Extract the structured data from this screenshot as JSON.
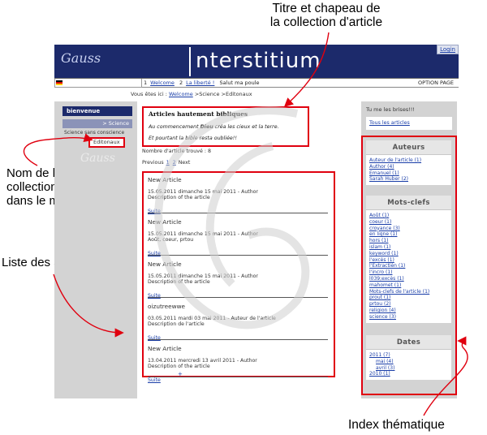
{
  "annotations": {
    "title_callout": [
      "Titre et chapeau de",
      "la collection d'article"
    ],
    "menu_callout": [
      "Nom de la",
      "collection d'article",
      "dans le menu"
    ],
    "list_callout": "Liste des articles",
    "index_callout": "Index thématique"
  },
  "site": {
    "logo_text": "Gauss",
    "title": "nterstitium",
    "login": "Login",
    "nav": {
      "item1_num": "1",
      "item1_label": "Welcome",
      "item2_num": "2",
      "item2_label": "La liberté !",
      "item3_label": "Salut ma poule",
      "option_page": "OPTION PAGE"
    },
    "breadcrumb": {
      "prefix": "Vous êtes ici :",
      "link": "Welcome",
      "rest": ">Science >Editonaux"
    }
  },
  "left_menu": {
    "bienvenue": "bienvenue",
    "science": "> Science",
    "science_sub": "Science sans conscience",
    "editonaux": "Editonaux"
  },
  "main": {
    "chapeau_title": "Articles hautement bibliques",
    "chapeau_line1_pre": "Au commencement",
    "chapeau_line1_bold": "Dieu",
    "chapeau_line1_post": "créa les cieux et la terre.",
    "chapeau_line2": "Et pourtant la bible resta oubliée!!",
    "count_text": "Nombre d'article trouvé : 8",
    "pager": {
      "prev": "Previous",
      "page1": "1",
      "page2": "2",
      "next": "Next"
    },
    "articles": [
      {
        "title": "New Article",
        "meta": "15.05.2011 dimanche 15 mai 2011 - Author",
        "desc": "Description of the article",
        "more": "Suite"
      },
      {
        "title": "New Article",
        "meta": "15.05.2011 dimanche 15 mai 2011 - Author",
        "desc": "Août, coeur, prtou",
        "more": "Suite"
      },
      {
        "title": "New Article",
        "meta": "15.05.2011 dimanche 15 mai 2011 - Author",
        "desc": "Description of the article",
        "more": "Suite"
      },
      {
        "title": "oizutreewwe",
        "meta": "03.05.2011 mardi 03 mai 2011 - Auteur de l'article",
        "desc": "Description de l'article",
        "more": "Suite"
      },
      {
        "title": "New Article",
        "meta": "13.04.2011 mercredi 13 avril 2011 - Author",
        "desc": "Description of the article",
        "more": "Suite"
      }
    ],
    "bottom_mark": "+"
  },
  "right": {
    "tagline": "Tu me les brises!!!",
    "all_articles": "Tous les articles",
    "authors_heading": "Auteurs",
    "authors": [
      "Auteur de l'article (1)",
      "Author (4)",
      "Emanuel (1)",
      "Sarah Huber (2)"
    ],
    "keywords_heading": "Mots-clefs",
    "keywords": [
      "Août (1)",
      "coeur (1)",
      "croyance (3)",
      "en ligne (1)",
      "hors (1)",
      "islam (1)",
      "keyword (1)",
      "l'excès (1)",
      "l'Extractièn (1)",
      "l'incro (1)",
      "l039;excès (1)",
      "mahomet (1)",
      "Mots-clefs de l'article (1)",
      "prout (1)",
      "prtou (2)",
      "religion (4)",
      "science (3)"
    ],
    "dates_heading": "Dates",
    "dates": [
      {
        "label": "2011 (7)",
        "indent": false
      },
      {
        "label": "mai (4)",
        "indent": true
      },
      {
        "label": "avril (3)",
        "indent": true
      },
      {
        "label": "2010 (1)",
        "indent": false
      }
    ]
  },
  "colors": {
    "header_blue": "#1c2a6b",
    "highlight_red": "#e0000f",
    "sidebar_grey": "#d3d3d3",
    "link_blue": "#1a3ea8"
  }
}
